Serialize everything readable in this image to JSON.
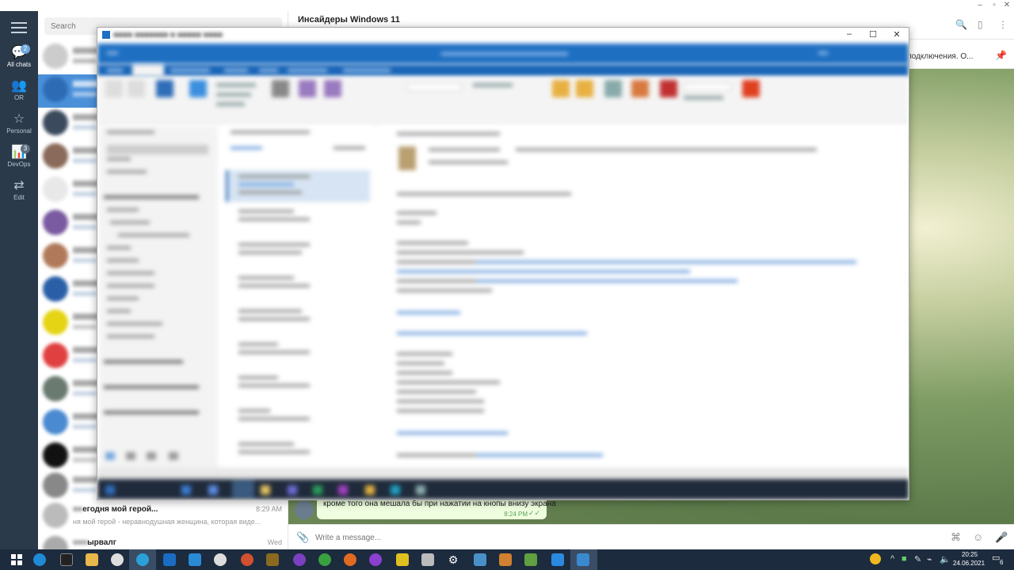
{
  "telegram": {
    "search_placeholder": "Search",
    "folders": [
      {
        "label": "All chats",
        "badge": "2",
        "icon": "chat-bubble-icon"
      },
      {
        "label": "OR",
        "badge": "",
        "icon": "people-icon"
      },
      {
        "label": "Personal",
        "badge": "",
        "icon": "star-icon"
      },
      {
        "label": "DevOps",
        "badge": "3",
        "icon": "chart-icon"
      },
      {
        "label": "Edit",
        "badge": "",
        "icon": "sliders-icon"
      }
    ],
    "chat_header": {
      "title": "Инсайдеры Windows 11"
    },
    "pinned_text": "ого подключения. О...",
    "visible_chats": [
      {
        "name_suffix": "егодня мой герой...",
        "time": "8:29 AM",
        "preview": "ня мой герой - неравнодушная женщина, которая виде..."
      },
      {
        "name_suffix": "ырвалг",
        "time": "Wed",
        "preview": ""
      }
    ],
    "message": {
      "text": "кроме того она мешала бы при нажатии на кнопы внизу экрана",
      "time": "8:24 PM",
      "check": "✓✓"
    },
    "compose_placeholder": "Write a message..."
  },
  "taskbar": {
    "time": "20:25",
    "date": "24.06.2021",
    "notification_count": "6"
  },
  "colors": {
    "sidebar": "#2b3a4a",
    "accent": "#4aa3f0",
    "outlook_blue": "#1e6fc2",
    "taskbar": "#1c2b3e",
    "bubble": "#eefedf"
  }
}
